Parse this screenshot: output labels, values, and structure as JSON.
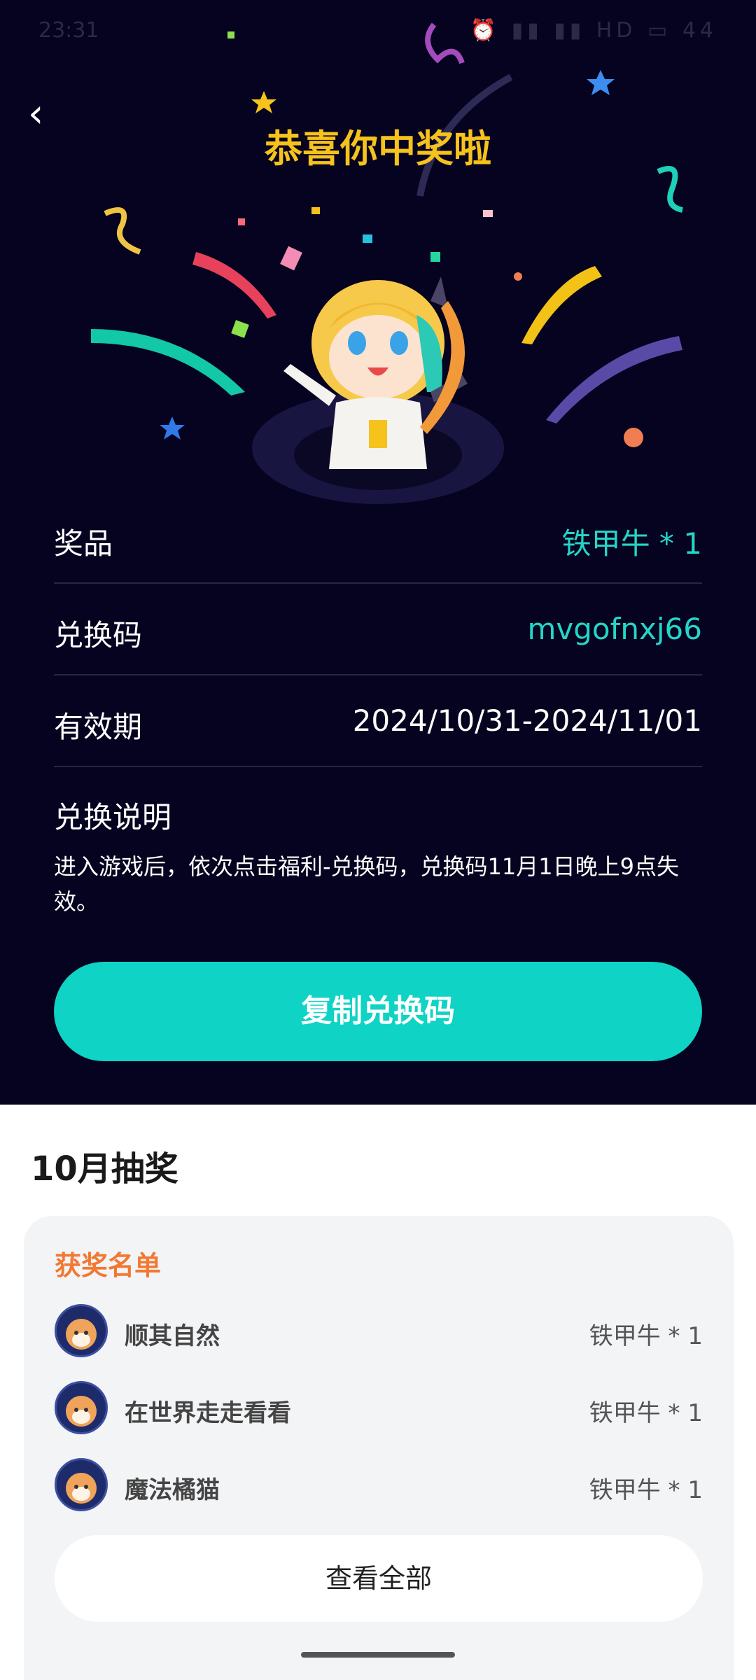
{
  "status": {
    "time": "23:31",
    "icons": "⏰ ▮▮ ▮▮ HD ▭ 44"
  },
  "header": {
    "title": "恭喜你中奖啦"
  },
  "info": {
    "prize_label": "奖品",
    "prize_value": "铁甲牛 * 1",
    "code_label": "兑换码",
    "code_value": "mvgofnxj66",
    "valid_label": "有效期",
    "valid_value": "2024/10/31-2024/11/01",
    "desc_title": "兑换说明",
    "desc_text": "进入游戏后，依次点击福利-兑换码，兑换码11月1日晚上9点失效。"
  },
  "actions": {
    "copy_label": "复制兑换码"
  },
  "lottery": {
    "month_title": "10月抽奖",
    "list_title": "获奖名单",
    "winners": [
      {
        "name": "顺其自然",
        "prize": "铁甲牛 * 1"
      },
      {
        "name": "在世界走走看看",
        "prize": "铁甲牛 * 1"
      },
      {
        "name": "魔法橘猫",
        "prize": "铁甲牛 * 1"
      }
    ],
    "view_all": "查看全部"
  },
  "colors": {
    "accent": "#0ed3c5",
    "title": "#f6c21c",
    "bg": "#05031f",
    "list_title": "#f27933"
  }
}
